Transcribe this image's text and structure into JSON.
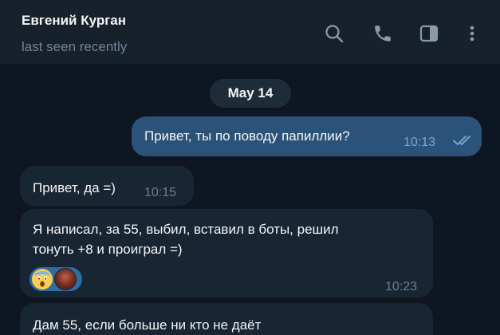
{
  "header": {
    "name": "Евгений Курган",
    "status": "last seen recently",
    "icons": [
      "search-icon",
      "phone-icon",
      "sidebar-toggle-icon",
      "more-vert-icon"
    ]
  },
  "chat": {
    "date_separator": "May 14",
    "messages": [
      {
        "direction": "outgoing",
        "text": "Привет, ты по поводу папиллии?",
        "time": "10:13",
        "status": "read"
      },
      {
        "direction": "incoming",
        "text": "Привет, да =)",
        "time": "10:15"
      },
      {
        "direction": "incoming",
        "text_line1": "Я написал, за 55, выбил, вставил в боты, решил",
        "text_line2": "тонуть +8 и проиграл =)",
        "time": "10:23",
        "reaction": "scream-emoji"
      },
      {
        "direction": "incoming",
        "text": "Дам 55, если больше ни кто не даёт"
      }
    ]
  },
  "colors": {
    "background": "#0e1621",
    "header": "#17212b",
    "outgoing_bubble": "#2b5278",
    "incoming_bubble": "#182533",
    "muted_text": "#708499",
    "read_check": "#4fae4e"
  }
}
